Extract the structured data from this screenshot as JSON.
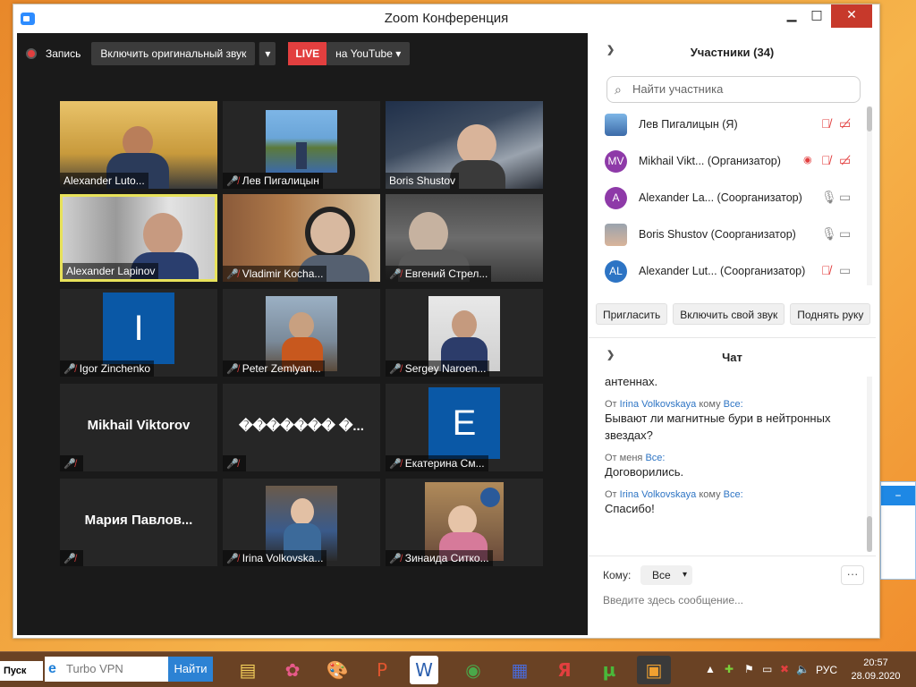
{
  "window": {
    "title": "Zoom Конференция"
  },
  "toolbar": {
    "record_label": "Запись",
    "original_audio_label": "Включить оригинальный звук",
    "live_label": "LIVE",
    "youtube_label": "на YouTube"
  },
  "tiles": [
    {
      "name": "Alexander Luto...",
      "muted": false
    },
    {
      "name": "Лев Пигалицын",
      "muted": true
    },
    {
      "name": "Boris Shustov",
      "muted": false
    },
    {
      "name": "Alexander Lapinov",
      "muted": false
    },
    {
      "name": "Vladimir Kocha...",
      "muted": true
    },
    {
      "name": "Евгений Стрел...",
      "muted": true
    },
    {
      "name": "Igor Zinchenko",
      "muted": true,
      "letter": "I"
    },
    {
      "name": "Peter Zemlyan...",
      "muted": true
    },
    {
      "name": "Sergey Naroen...",
      "muted": true
    },
    {
      "name": "",
      "muted": true,
      "display": "Mikhail Viktorov"
    },
    {
      "name": "",
      "muted": true,
      "display": "������� �..."
    },
    {
      "name": "Екатерина См...",
      "muted": true,
      "letter": "E"
    },
    {
      "name": "",
      "muted": true,
      "display": "Мария  Павлов..."
    },
    {
      "name": "Irina Volkovska...",
      "muted": true
    },
    {
      "name": "Зинаида Ситко...",
      "muted": true
    }
  ],
  "participants": {
    "header": "Участники (34)",
    "search_placeholder": "Найти участника",
    "list": [
      {
        "avatar": "",
        "name": "Лев Пигалицын (Я)",
        "mic": "muted",
        "video": "off"
      },
      {
        "avatar": "MV",
        "name": "Mikhail Vikt...  (Организатор)",
        "mic": "muted",
        "video": "off",
        "recording": true
      },
      {
        "avatar": "A",
        "name": "Alexander La...  (Соорганизатор)",
        "mic": "on",
        "video": "on"
      },
      {
        "avatar": "",
        "name": "Boris Shustov (Соорганизатор)",
        "mic": "on",
        "video": "on"
      },
      {
        "avatar": "AL",
        "name": "Alexander Lut...  (Соорганизатор)",
        "mic": "muted",
        "video": "on"
      }
    ],
    "invite_label": "Пригласить",
    "unmute_label": "Включить свой звук",
    "raise_hand_label": "Поднять руку"
  },
  "chat": {
    "header": "Чат",
    "messages": [
      {
        "from": "",
        "to": "",
        "text": "антеннах."
      },
      {
        "from": "Irina Volkovskaya",
        "to": "Все:",
        "text": "Бывают ли магнитные бури в нейтронных звездах?"
      },
      {
        "from": "",
        "to": "Все:",
        "text": "Договорились.",
        "self": true
      },
      {
        "from": "Irina Volkovskaya",
        "to": "Все:",
        "text": "Спасибо!"
      }
    ],
    "label_from": "От",
    "label_to": "кому",
    "label_from_me": "От меня",
    "to_label": "Кому:",
    "to_value": "Все",
    "placeholder": "Введите здесь сообщение..."
  },
  "taskbar": {
    "start_label": "Пуск",
    "search_value": "Turbo VPN",
    "search_button": "Найти",
    "lang": "РУС",
    "time": "20:57",
    "date": "28.09.2020"
  },
  "colors": {
    "accent": "#2d8cff",
    "mute_red": "#e23f3f",
    "active_border": "#e8e25a",
    "live": "#e23f3f"
  }
}
